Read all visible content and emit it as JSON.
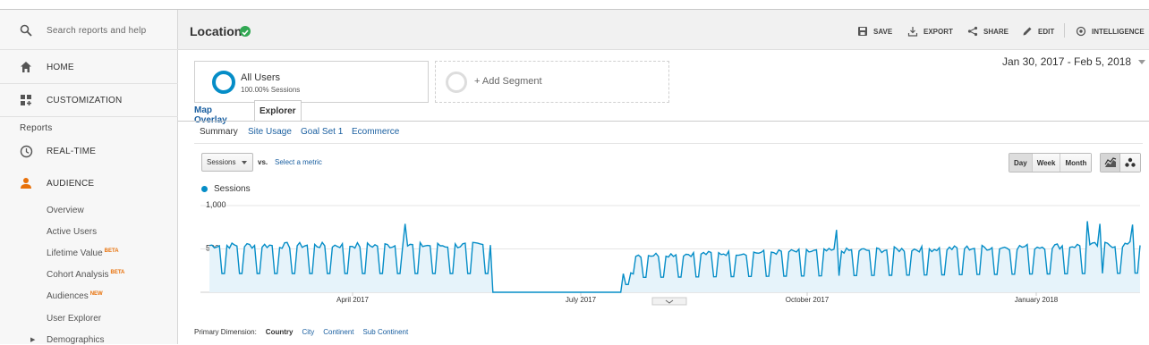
{
  "top_fragment": "",
  "sidebar": {
    "search_placeholder": "Search reports and help",
    "home": "HOME",
    "customization": "CUSTOMIZATION",
    "reports_header": "Reports",
    "realtime": "REAL-TIME",
    "audience": "AUDIENCE",
    "sub_items": [
      {
        "label": "Overview",
        "badge": ""
      },
      {
        "label": "Active Users",
        "badge": ""
      },
      {
        "label": "Lifetime Value",
        "badge": "BETA"
      },
      {
        "label": "Cohort Analysis",
        "badge": "BETA"
      },
      {
        "label": "Audiences",
        "badge": "NEW"
      },
      {
        "label": "User Explorer",
        "badge": ""
      },
      {
        "label": "Demographics",
        "badge": ""
      }
    ]
  },
  "header": {
    "title": "Location",
    "toolbar": {
      "save": "SAVE",
      "export": "EXPORT",
      "share": "SHARE",
      "edit": "EDIT",
      "intelligence": "INTELLIGENCE"
    }
  },
  "segments": {
    "active": {
      "name": "All Users",
      "detail": "100.00% Sessions"
    },
    "add": "+ Add Segment"
  },
  "date_range": "Jan 30, 2017 - Feb 5, 2018",
  "tabs": {
    "map_overlay": "Map Overlay",
    "explorer": "Explorer"
  },
  "subtabs": [
    "Summary",
    "Site Usage",
    "Goal Set 1",
    "Ecommerce"
  ],
  "metric_selector": {
    "value": "Sessions",
    "vs": "vs.",
    "select_metric": "Select a metric"
  },
  "granularity": [
    "Day",
    "Week",
    "Month"
  ],
  "accent_color": "#058dc7",
  "chart_data": {
    "type": "area",
    "series": [
      {
        "name": "Sessions",
        "values": []
      }
    ],
    "y_ticks": [
      "1,000",
      "500"
    ],
    "x_ticks": [
      "April 2017",
      "July 2017",
      "October 2017",
      "January 2018"
    ],
    "ylim": [
      0,
      1000
    ],
    "grid": true
  },
  "primary_dimension": {
    "label": "Primary Dimension:",
    "active": "Country",
    "options": [
      "City",
      "Continent",
      "Sub Continent"
    ]
  }
}
